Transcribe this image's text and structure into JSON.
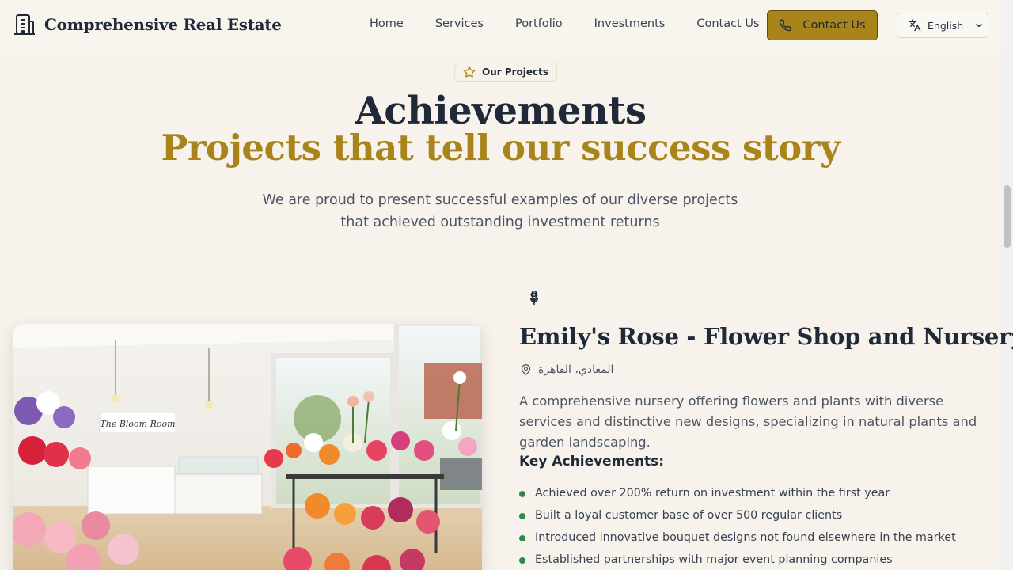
{
  "header": {
    "brand": "Comprehensive Real Estate",
    "brand_icon": "building-icon",
    "nav": [
      "Home",
      "Services",
      "Portfolio",
      "Investments",
      "Contact Us"
    ],
    "cta_label": "Contact Us",
    "cta_icon": "phone-icon",
    "language": "English",
    "language_icon": "translate-icon"
  },
  "section": {
    "badge": "Our Projects",
    "badge_icon": "star-icon",
    "title": "Achievements",
    "subtitle": "Projects that tell our success story",
    "intro": "We are proud to present successful examples of our diverse projects that achieved outstanding investment returns"
  },
  "project": {
    "icon": "flower-icon",
    "title": "Emily's Rose - Flower Shop and Nursery",
    "location": "المعادي، القاهرة",
    "location_icon": "map-pin-icon",
    "image_sign_text": "The Bloom Room",
    "description": "A comprehensive nursery offering flowers and plants with diverse services and distinctive new designs, specializing in natural plants and garden landscaping.",
    "achievements_title": "Key Achievements:",
    "achievements": [
      "Achieved over 200% return on investment within the first year",
      "Built a loyal customer base of over 500 regular clients",
      "Introduced innovative bouquet designs not found elsewhere in the market",
      "Established partnerships with major event planning companies"
    ]
  },
  "colors": {
    "accent": "#a8841a",
    "background": "#f7f3ec",
    "bullet": "#2f8a48",
    "text": "#1f2937"
  }
}
